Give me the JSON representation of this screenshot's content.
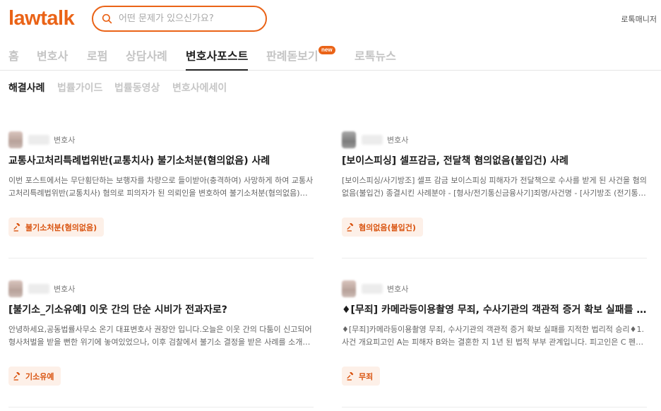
{
  "header": {
    "logo": "lawtalk",
    "search_placeholder": "어떤 문제가 있으신가요?",
    "manager_link": "로톡매니저"
  },
  "gnb": {
    "items": [
      {
        "label": "홈"
      },
      {
        "label": "변호사"
      },
      {
        "label": "로펌"
      },
      {
        "label": "상담사례"
      },
      {
        "label": "변호사포스트"
      },
      {
        "label": "판례돋보기",
        "badge": "new"
      },
      {
        "label": "로톡뉴스"
      }
    ],
    "active": "변호사포스트"
  },
  "subnav": {
    "items": [
      {
        "label": "해결사례"
      },
      {
        "label": "법률가이드"
      },
      {
        "label": "법률동영상"
      },
      {
        "label": "변호사에세이"
      }
    ],
    "active": "해결사례"
  },
  "cards": [
    {
      "role": "변호사",
      "title": "교통사고처리특례법위반(교통치사) 불기소처분(혐의없음) 사례",
      "desc": "이번 포스트에서는 무단횡단하는 보행자를 차량으로 들이받아(충격하여) 사망하게 하여 교통사고처리특례법위반(교통치사) 혐의로 피의자가 된 의뢰인을 변호하여 불기소처분(혐의없음)을 받은 사례를 소개합니다.",
      "tag": "불기소처분(혐의없음)"
    },
    {
      "role": "변호사",
      "title": "[보이스피싱] 셀프감금, 전달책 혐의없음(불입건) 사례",
      "desc": "[보이스피싱/사기방조] 셀프 감금 보이스피싱 피해자가 전달책으로 수사를 받게 된 사건을 혐의없음(불입건) 종결시킨 사례분야 - [형사/전기통신금융사기]죄명/사건명 - [사기방조 (전기통신금융사기)]",
      "tag": "혐의없음(불입건)"
    },
    {
      "role": "변호사",
      "title": "[불기소_기소유예] 이웃 간의 단순 시비가 전과자로?",
      "desc": "안녕하세요,공동법률사무소 온기 대표변호사 권장안 입니다.오늘은 이웃 간의 다툼이 신고되어 형사처벌을 받을 뻔한 위기에 놓여있었으나, 이후 검찰에서 불기소 결정을 받은 사례를 소개해드리겠습니다.",
      "tag": "기소유예"
    },
    {
      "role": "변호사",
      "title": "♦[무죄] 카메라등이용촬영 무죄, 수사기관의 객관적 증거 확보 실패를 지적한 법리적 승리",
      "desc": "♦[무죄]카메라등이용촬영 무죄, 수사기관의 객관적 증거 확보 실패를 지적한 법리적 승리♦1. 사건 개요피고인 A는 피해자 B와는 결혼한 지 1년 된 법적 부부 관계입니다. 피고인은 C 펜션 객실에서",
      "tag": "무죄"
    }
  ],
  "colors": {
    "brand": "#ea6317",
    "tag_bg": "#fdf0e8",
    "tag_text": "#d9530f"
  }
}
